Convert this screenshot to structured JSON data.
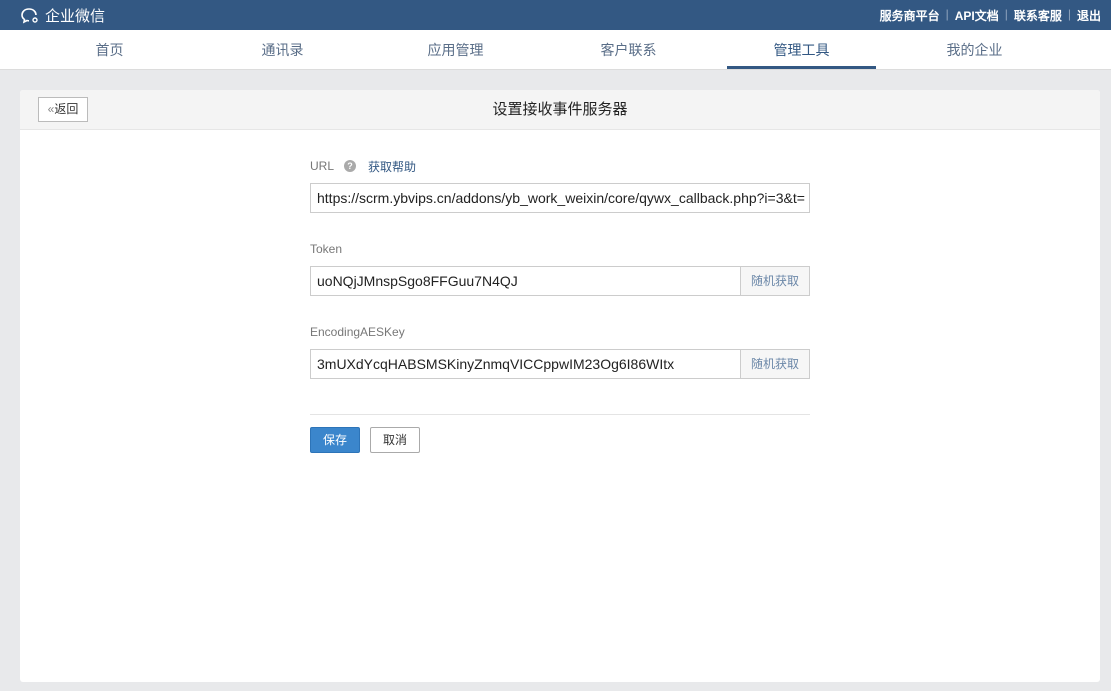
{
  "app": {
    "name": "企业微信",
    "links": [
      "服务商平台",
      "API文档",
      "联系客服",
      "退出"
    ]
  },
  "nav": {
    "items": [
      "首页",
      "通讯录",
      "应用管理",
      "客户联系",
      "管理工具",
      "我的企业"
    ],
    "active": 4
  },
  "page": {
    "back": "返回",
    "title": "设置接收事件服务器"
  },
  "form": {
    "url": {
      "label": "URL",
      "help": "获取帮助",
      "value": "https://scrm.ybvips.cn/addons/yb_work_weixin/core/qywx_callback.php?i=3&t="
    },
    "token": {
      "label": "Token",
      "value": "uoNQjJMnspSgo8FFGuu7N4QJ",
      "random": "随机获取"
    },
    "aes": {
      "label": "EncodingAESKey",
      "value": "3mUXdYcqHABSMSKinyZnmqVICCppwIM23Og6I86WItx",
      "random": "随机获取"
    },
    "save": "保存",
    "cancel": "取消"
  }
}
